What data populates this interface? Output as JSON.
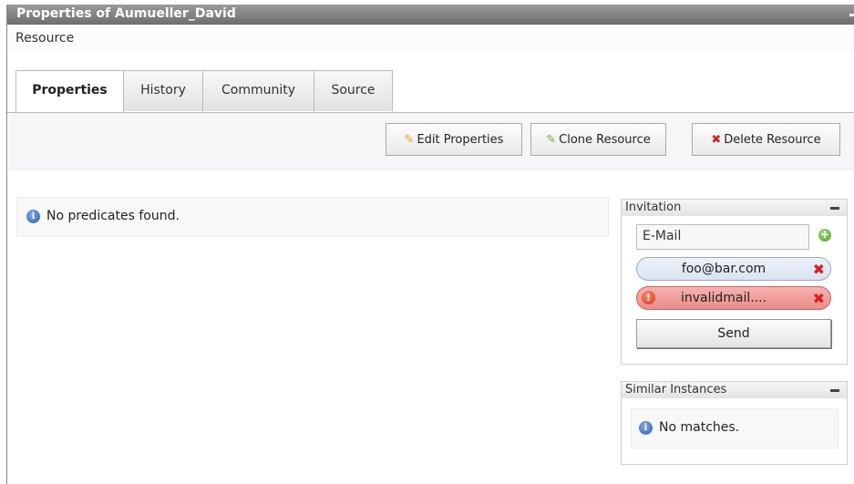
{
  "window": {
    "title": "Properties of Aumueller_David"
  },
  "breadcrumb": {
    "text": "Resource"
  },
  "tabs": [
    {
      "label": "Properties",
      "active": true
    },
    {
      "label": "History",
      "active": false
    },
    {
      "label": "Community",
      "active": false
    },
    {
      "label": "Source",
      "active": false
    }
  ],
  "toolbar": {
    "edit_label": "Edit Properties",
    "clone_label": "Clone Resource",
    "delete_label": "Delete Resource"
  },
  "main": {
    "message": "No predicates found."
  },
  "invitation": {
    "title": "Invitation",
    "email_placeholder": "E-Mail",
    "emails": [
      {
        "address": "foo@bar.com",
        "valid": true
      },
      {
        "address": "invalidmail....",
        "valid": false
      }
    ],
    "send_label": "Send"
  },
  "similar": {
    "title": "Similar Instances",
    "message": "No matches."
  },
  "icons": {
    "edit": "pencil-icon",
    "clone": "clone-icon",
    "delete": "delete-x-icon",
    "info": "info-icon",
    "add": "add-plus-icon",
    "remove": "remove-x-icon",
    "warning": "warning-icon"
  },
  "colors": {
    "titlebar": "#7d7d7d",
    "toolbar_bg": "#f5f6f8",
    "chip_valid": "#dde6f2",
    "chip_invalid": "#ef9d99",
    "delete_red": "#d81e1e"
  }
}
